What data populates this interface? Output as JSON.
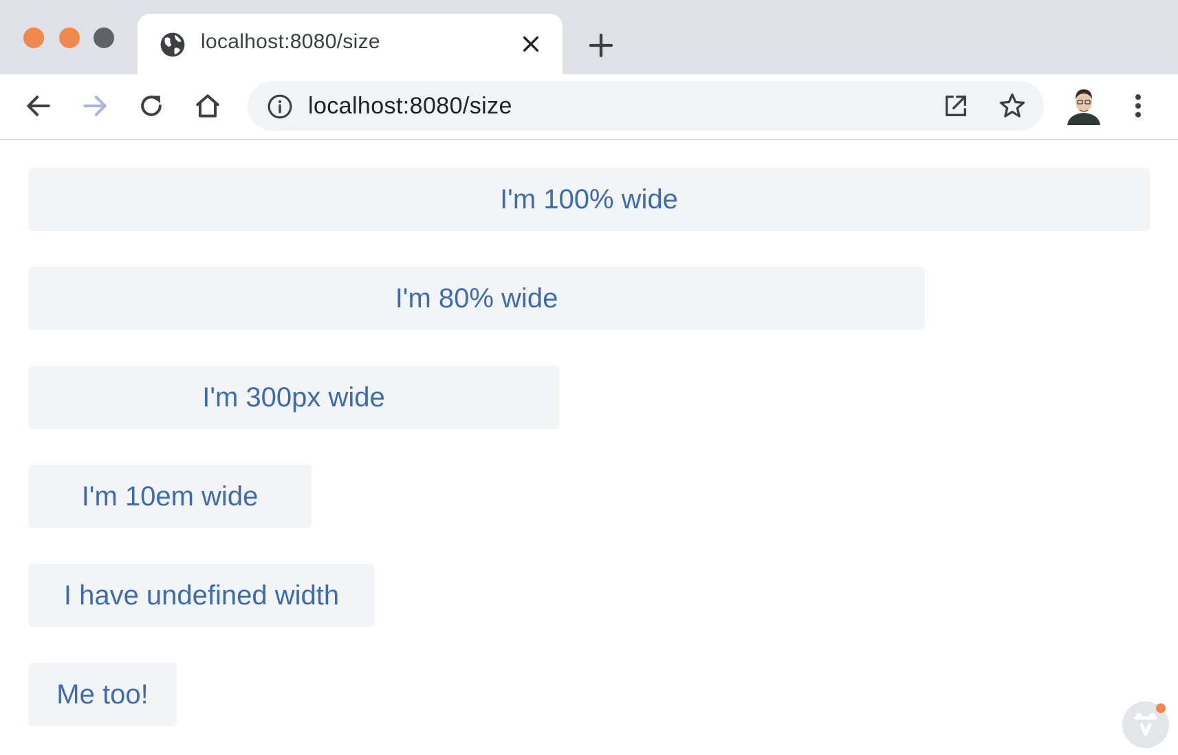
{
  "window": {
    "traffic_lights": [
      {
        "name": "close",
        "color": "#f0894d"
      },
      {
        "name": "minimize",
        "color": "#f0894d"
      },
      {
        "name": "maximize",
        "color": "#5f6368"
      }
    ]
  },
  "tab": {
    "title": "localhost:8080/size",
    "icon": "globe-icon",
    "close_icon": "close-icon"
  },
  "new_tab_icon": "plus-icon",
  "toolbar": {
    "back_icon": "arrow-left-icon",
    "forward_icon": "arrow-right-icon",
    "reload_icon": "reload-icon",
    "home_icon": "home-icon",
    "url": "localhost:8080/size",
    "site_info_icon": "info-icon",
    "open_external_icon": "external-link-icon",
    "bookmark_icon": "star-icon",
    "profile_icon": "avatar",
    "menu_icon": "kebab-menu-icon"
  },
  "buttons": [
    {
      "label": "I'm 100% wide"
    },
    {
      "label": "I'm 80% wide"
    },
    {
      "label": "I'm 300px wide"
    },
    {
      "label": "I'm 10em wide"
    },
    {
      "label": "I have undefined width"
    },
    {
      "label": "Me too!"
    }
  ],
  "colors": {
    "button_text": "#3d6baf",
    "button_bg": "#f3f4f5",
    "accent": "#f0894d"
  },
  "dev_badge_icon": "vaadin-icon"
}
